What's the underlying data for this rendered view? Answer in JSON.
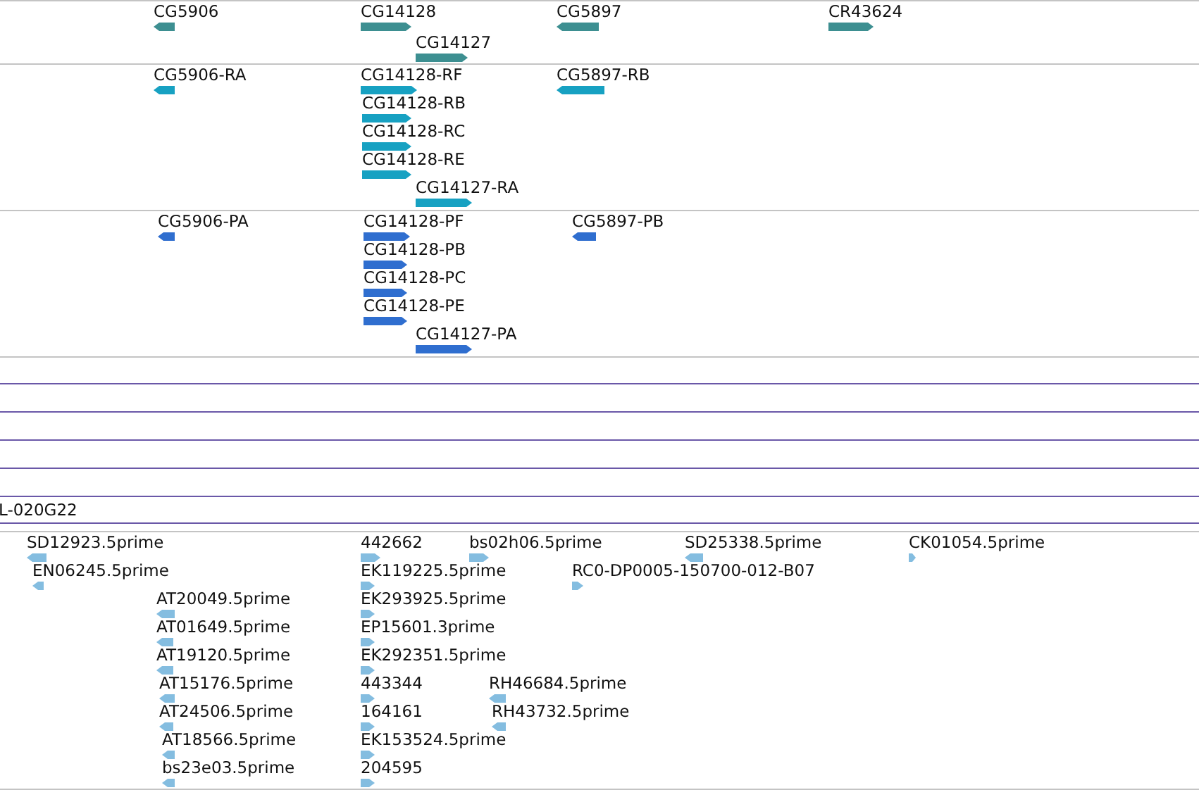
{
  "tracks": [
    {
      "kind": "gene",
      "features": [
        {
          "label": "CG5906",
          "reverse": true
        },
        {
          "label": "CG14128",
          "reverse": false
        },
        {
          "label": "CG5897",
          "reverse": true
        },
        {
          "label": "CR43624",
          "reverse": false
        },
        {
          "label": "CG14127",
          "reverse": false
        }
      ]
    },
    {
      "kind": "transcript",
      "features": [
        {
          "label": "CG5906-RA",
          "reverse": true
        },
        {
          "label": "CG14128-RF",
          "reverse": false
        },
        {
          "label": "CG5897-RB",
          "reverse": true
        },
        {
          "label": "CG14128-RB",
          "reverse": false
        },
        {
          "label": "CG14128-RC",
          "reverse": false
        },
        {
          "label": "CG14128-RE",
          "reverse": false
        },
        {
          "label": "CG14127-RA",
          "reverse": false
        }
      ]
    },
    {
      "kind": "protein",
      "features": [
        {
          "label": "CG5906-PA",
          "reverse": true
        },
        {
          "label": "CG14128-PF",
          "reverse": false
        },
        {
          "label": "CG5897-PB",
          "reverse": true
        },
        {
          "label": "CG14128-PB",
          "reverse": false
        },
        {
          "label": "CG14128-PC",
          "reverse": false
        },
        {
          "label": "CG14128-PE",
          "reverse": false
        },
        {
          "label": "CG14127-PA",
          "reverse": false
        }
      ]
    },
    {
      "kind": "clone",
      "label": "L-020G22"
    },
    {
      "kind": "est",
      "features": [
        {
          "label": "SD12923.5prime",
          "reverse": true
        },
        {
          "label": "442662",
          "reverse": false
        },
        {
          "label": "bs02h06.5prime",
          "reverse": false
        },
        {
          "label": "SD25338.5prime",
          "reverse": true
        },
        {
          "label": "CK01054.5prime",
          "reverse": false
        },
        {
          "label": "EN06245.5prime",
          "reverse": true
        },
        {
          "label": "EK119225.5prime",
          "reverse": false
        },
        {
          "label": "RC0-DP0005-150700-012-B07",
          "reverse": false
        },
        {
          "label": "AT20049.5prime",
          "reverse": true
        },
        {
          "label": "EK293925.5prime",
          "reverse": false
        },
        {
          "label": "AT01649.5prime",
          "reverse": true
        },
        {
          "label": "EP15601.3prime",
          "reverse": false
        },
        {
          "label": "AT19120.5prime",
          "reverse": true
        },
        {
          "label": "EK292351.5prime",
          "reverse": false
        },
        {
          "label": "AT15176.5prime",
          "reverse": true
        },
        {
          "label": "443344",
          "reverse": false
        },
        {
          "label": "RH46684.5prime",
          "reverse": true
        },
        {
          "label": "AT24506.5prime",
          "reverse": true
        },
        {
          "label": "164161",
          "reverse": false
        },
        {
          "label": "RH43732.5prime",
          "reverse": true
        },
        {
          "label": "AT18566.5prime",
          "reverse": true
        },
        {
          "label": "EK153524.5prime",
          "reverse": false
        },
        {
          "label": "bs23e03.5prime",
          "reverse": true
        },
        {
          "label": "204595",
          "reverse": false
        }
      ]
    }
  ]
}
